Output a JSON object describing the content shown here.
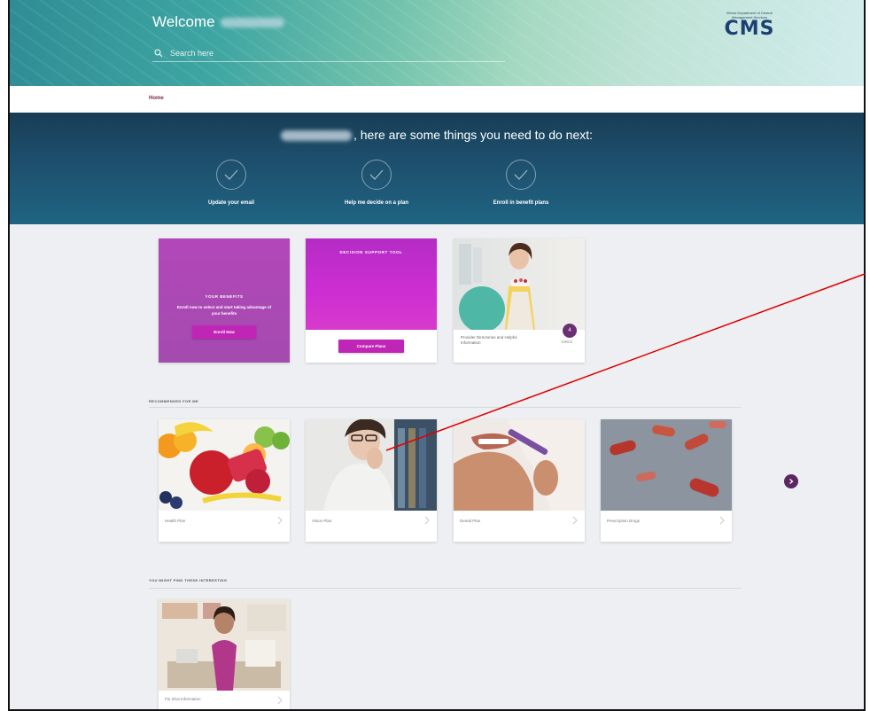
{
  "header": {
    "welcome_label": "Welcome",
    "search_placeholder": "Search here",
    "logo_text": "CMS",
    "logo_tagline": "Illinois Department of Central Management Services"
  },
  "breadcrumb": {
    "home": "Home"
  },
  "next_steps": {
    "title_suffix": ", here are some things you need to do next:",
    "items": [
      {
        "label": "Update your email"
      },
      {
        "label": "Help me decide on a plan"
      },
      {
        "label": "Enroll in benefit plans"
      }
    ]
  },
  "cards": {
    "benefits": {
      "title": "YOUR BENEFITS",
      "description": "Enroll now to select and start taking advantage of your benefits",
      "button": "Enroll Now"
    },
    "decision_support": {
      "title": "DECISION SUPPORT TOOL",
      "button": "Compare Plans"
    },
    "provider": {
      "caption": "Provider Directories and Helpful Information",
      "badge_count": "4",
      "badge_label": "TOPICS"
    }
  },
  "recommended": {
    "heading": "RECOMMENDED FOR ME",
    "tiles": [
      {
        "label": "Health Plan"
      },
      {
        "label": "Vision Plan"
      },
      {
        "label": "Dental Plan"
      },
      {
        "label": "Prescription Drugs"
      }
    ]
  },
  "interesting": {
    "heading": "YOU MIGHT FIND THESE INTERESTING",
    "tiles": [
      {
        "label": "Flu Shot Information"
      }
    ]
  },
  "colors": {
    "banner": "#1d4e6b",
    "accent_magenta": "#c026b6",
    "accent_purple": "#5c2661",
    "annotation": "#e00000"
  }
}
